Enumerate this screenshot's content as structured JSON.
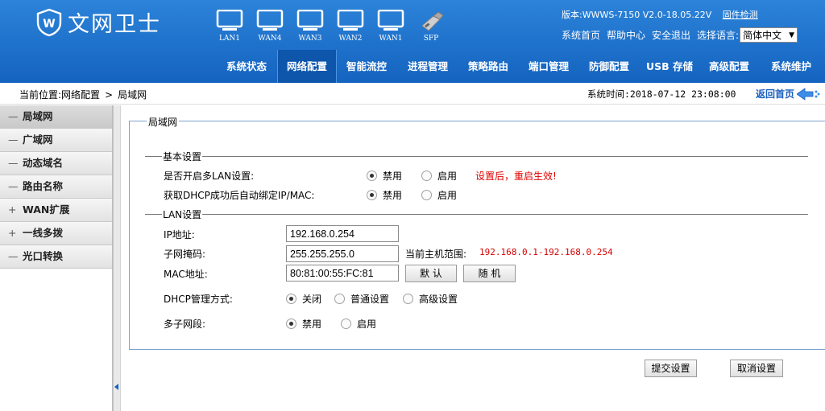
{
  "brand": {
    "name": "文网卫士"
  },
  "ports": [
    {
      "label": "LAN1",
      "icon": "monitor-icon"
    },
    {
      "label": "WAN4",
      "icon": "monitor-icon"
    },
    {
      "label": "WAN3",
      "icon": "monitor-icon"
    },
    {
      "label": "WAN2",
      "icon": "monitor-icon"
    },
    {
      "label": "WAN1",
      "icon": "monitor-icon"
    },
    {
      "label": "SFP",
      "icon": "sfp-module-icon"
    }
  ],
  "version": {
    "text": "版本:WWWS-7150 V2.0-18.05.22V",
    "firmware_check": "固件检测"
  },
  "top_links": {
    "home": "系统首页",
    "help": "帮助中心",
    "logout": "安全退出",
    "lang_label": "选择语言:",
    "lang_value": "简体中文"
  },
  "nav": [
    {
      "label": "系统状态"
    },
    {
      "label": "网络配置",
      "active": true
    },
    {
      "label": "智能流控"
    },
    {
      "label": "进程管理"
    },
    {
      "label": "策略路由"
    },
    {
      "label": "端口管理"
    },
    {
      "label": "防御配置"
    },
    {
      "label": "USB 存储"
    },
    {
      "label": "高级配置"
    },
    {
      "label": "系统维护"
    }
  ],
  "breadcrumb": {
    "prefix": "当前位置:网络配置",
    "sep": ">",
    "current": "局域网"
  },
  "system_time": "系统时间:2018-07-12 23:08:00",
  "back_home": "返回首页",
  "sidebar": [
    {
      "sym": "—",
      "label": "局域网",
      "selected": true
    },
    {
      "sym": "—",
      "label": "广域网"
    },
    {
      "sym": "—",
      "label": "动态域名"
    },
    {
      "sym": "—",
      "label": "路由名称"
    },
    {
      "sym": "+",
      "label": "WAN扩展"
    },
    {
      "sym": "+",
      "label": "一线多拨"
    },
    {
      "sym": "—",
      "label": "光口转换"
    }
  ],
  "panel": {
    "title": "局域网",
    "basic": {
      "title": "基本设置",
      "multi_lan": {
        "label": "是否开启多LAN设置:",
        "opt_disable": "禁用",
        "opt_enable": "启用",
        "selected": "禁用",
        "note": "设置后，重启生效!"
      },
      "dhcp_bind": {
        "label": "获取DHCP成功后自动绑定IP/MAC:",
        "opt_disable": "禁用",
        "opt_enable": "启用",
        "selected": "禁用"
      }
    },
    "lan": {
      "title": "LAN设置",
      "ip": {
        "label": "IP地址:",
        "value": "192.168.0.254"
      },
      "mask": {
        "label": "子网掩码:",
        "value": "255.255.255.0",
        "range_label": "当前主机范围:",
        "range_value": "192.168.0.1-192.168.0.254"
      },
      "mac": {
        "label": "MAC地址:",
        "value": "80:81:00:55:FC:81",
        "default_btn": "默 认",
        "random_btn": "随 机"
      },
      "dhcp_mode": {
        "label": "DHCP管理方式:",
        "opt_off": "关闭",
        "opt_normal": "普通设置",
        "opt_advanced": "高级设置",
        "selected": "关闭"
      },
      "multi_subnet": {
        "label": "多子网段:",
        "opt_disable": "禁用",
        "opt_enable": "启用",
        "selected": "禁用"
      }
    }
  },
  "actions": {
    "submit": "提交设置",
    "cancel": "取消设置"
  },
  "colors": {
    "header": "#1a6ccc",
    "nav_active": "#0d56ab",
    "alert_red": "#e00000",
    "panel_border": "#7ea3cf"
  }
}
